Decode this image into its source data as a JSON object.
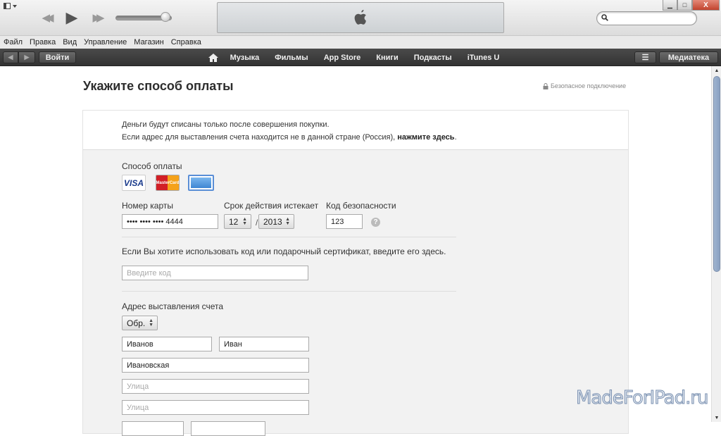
{
  "titlebar": {
    "icons": {
      "layout": "layout-toggle-icon",
      "rewind": "rewind-icon",
      "play": "play-icon",
      "fast_forward": "fast-forward-icon",
      "apple": "apple-logo-icon",
      "search": "search-icon"
    },
    "rewind_glyph": "◀◀",
    "play_glyph": "▶",
    "ff_glyph": "▶▶",
    "volume_level": 0.9,
    "window_buttons": {
      "minimize": "▁",
      "maximize": "□",
      "close": "X"
    },
    "search_placeholder": ""
  },
  "menubar": {
    "items": [
      "Файл",
      "Правка",
      "Вид",
      "Управление",
      "Магазин",
      "Справка"
    ]
  },
  "navbar": {
    "back": "◀",
    "forward": "▶",
    "login": "Войти",
    "list": "☰",
    "library": "Медиатека",
    "store_links": [
      "Музыка",
      "Фильмы",
      "App Store",
      "Книги",
      "Подкасты",
      "iTunes U"
    ]
  },
  "page": {
    "title": "Укажите способ оплаты",
    "secure": "Безопасное подключение",
    "info_line1": "Деньги будут списаны только после совершения покупки.",
    "info_line2": "Если адрес для выставления счета находится не в данной стране (Россия), ",
    "info_link": "нажмите здесь",
    "info_end": ".",
    "payment_method_label": "Способ оплаты",
    "cards": {
      "visa": "VISA",
      "mastercard": "MasterCard",
      "amex": "American Express"
    },
    "card_number_label": "Номер карты",
    "card_number": "•••• •••• •••• 4444",
    "expiry_label": "Срок действия истекает",
    "expiry_month": "12",
    "expiry_year": "2013",
    "expiry_sep": "/",
    "cvv_label": "Код безопасности",
    "cvv": "123",
    "help": "?",
    "code_label": "Если Вы хотите использовать код или подарочный сертификат, введите его здесь.",
    "code_placeholder": "Введите код",
    "billing_label": "Адрес выставления счета",
    "salutation": "Обр.",
    "last_name": "Иванов",
    "first_name": "Иван",
    "middle_name": "Ивановская",
    "street1_placeholder": "Улица",
    "street2_placeholder": "Улица"
  },
  "scrollbar": {
    "up": "▲",
    "down": "▼",
    "position": 0.0
  },
  "watermark": "MadeForIPad.ru"
}
